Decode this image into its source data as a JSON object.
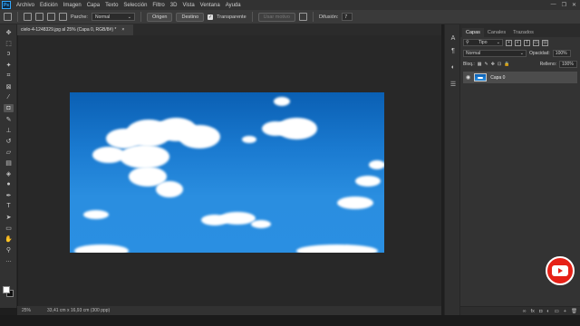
{
  "menubar": {
    "logo": "Ps",
    "items": [
      "Archivo",
      "Edición",
      "Imagen",
      "Capa",
      "Texto",
      "Selección",
      "Filtro",
      "3D",
      "Vista",
      "Ventana",
      "Ayuda"
    ],
    "window_controls": [
      "—",
      "❐",
      "✕"
    ]
  },
  "options": {
    "parche_label": "Parche:",
    "parche_value": "Normal",
    "origen_label": "Origen",
    "destino_label": "Destino",
    "transparente_label": "Transparente",
    "usar_motivo_label": "Usar motivo",
    "difusion_label": "Difusión:",
    "difusion_value": "7"
  },
  "document": {
    "tab_title": "cielo-4-1248329.jpg al 25% (Capa 0, RGB/8#) *",
    "tab_close": "×"
  },
  "status": {
    "zoom": "25%",
    "doc_info": "33,41 cm x 16,93 cm (300 ppp)"
  },
  "panel": {
    "tabs": [
      "Capas",
      "Canales",
      "Trazados"
    ],
    "filter_kind": "Tipo",
    "blend_mode": "Normal",
    "opacity_label": "Opacidad:",
    "opacity_value": "100%",
    "lock_label": "Bloq.:",
    "fill_label": "Relleno:",
    "fill_value": "100%",
    "layers": [
      {
        "name": "Capa 0"
      }
    ]
  },
  "colors": {
    "accent": "#31a8ff",
    "youtube": "#e62117",
    "sky": "#1a7ad0"
  }
}
